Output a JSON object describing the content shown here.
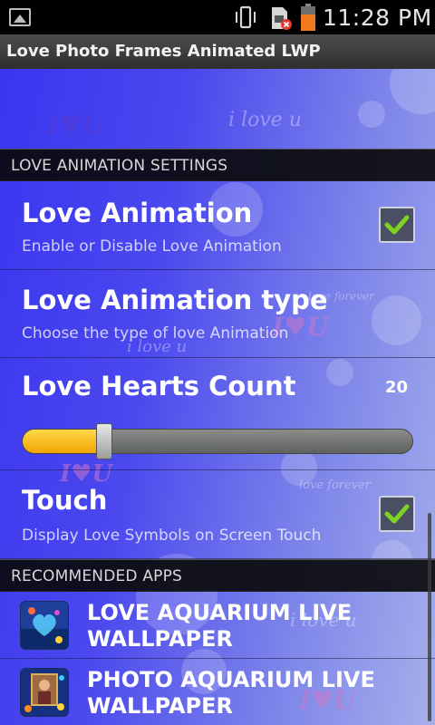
{
  "status_bar": {
    "time": "11:28 PM",
    "icons": [
      "image-notification-icon",
      "vibrate-icon",
      "no-sim-icon",
      "battery-icon"
    ]
  },
  "app_bar": {
    "title": "Love Photo Frames Animated LWP"
  },
  "decorations": {
    "iu": "I♥U",
    "i_love_u": "i love u",
    "love_forever": "love forever"
  },
  "love_settings": {
    "header": "LOVE ANIMATION SETTINGS",
    "love_animation": {
      "title": "Love Animation",
      "summary": "Enable or Disable Love Animation",
      "checked": true
    },
    "animation_type": {
      "title": "Love Animation type",
      "summary": "Choose the type of love Animation"
    },
    "hearts_count": {
      "title": "Love Hearts Count",
      "value": "20",
      "slider_fraction": 0.21
    },
    "touch": {
      "title": "Touch",
      "summary": "Display Love Symbols on Screen Touch",
      "checked": true
    }
  },
  "recommended": {
    "header": "RECOMMENDED APPS",
    "apps": [
      {
        "label": "LOVE AQUARIUM LIVE WALLPAPER"
      },
      {
        "label": "PHOTO AQUARIUM LIVE WALLPAPER"
      }
    ]
  },
  "colors": {
    "accent_yellow": "#f2b400",
    "check_green": "#7ed321",
    "wallpaper_blue": "#4a48ee"
  }
}
